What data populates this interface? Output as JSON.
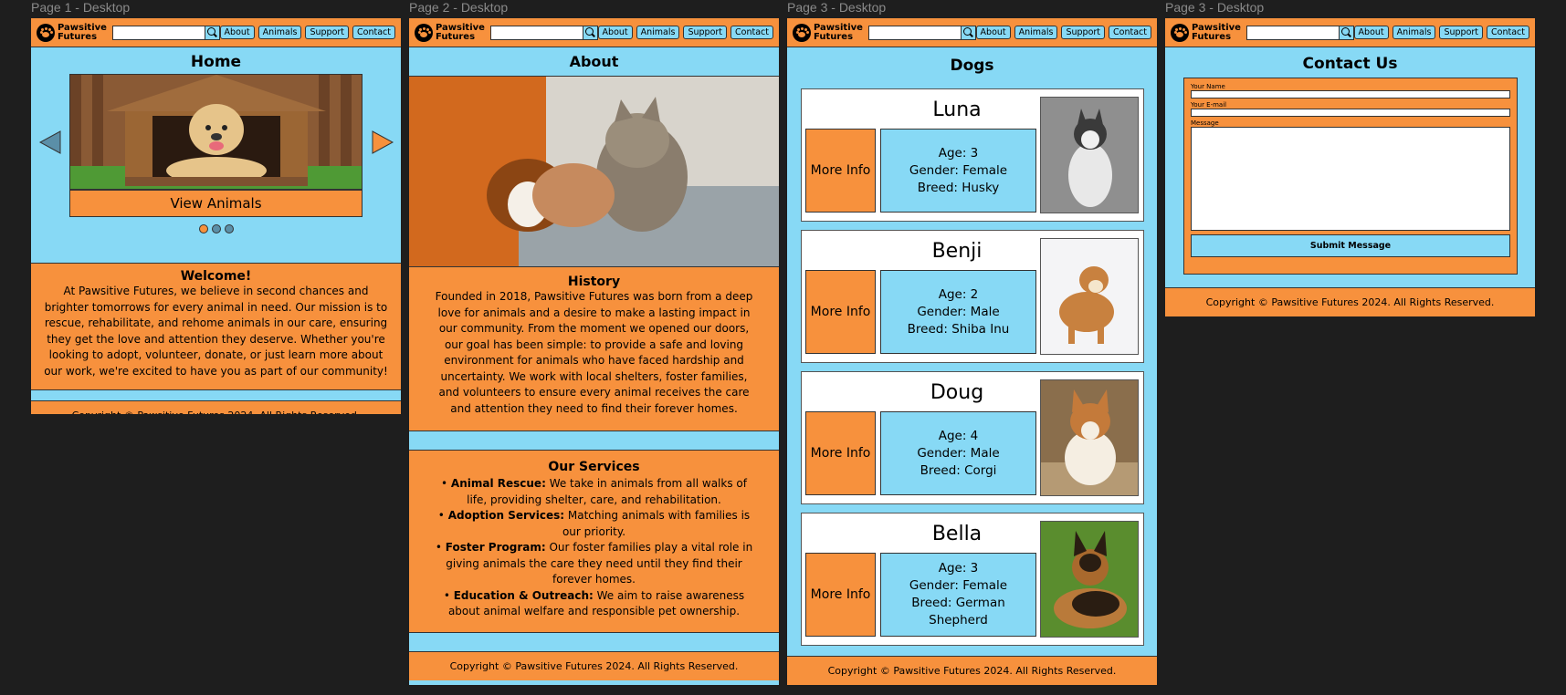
{
  "frames": [
    {
      "label": "Page 1 - Desktop"
    },
    {
      "label": "Page 2 - Desktop"
    },
    {
      "label": "Page 3 - Desktop"
    },
    {
      "label": "Page 3 - Desktop"
    }
  ],
  "nav": {
    "logo_line1": "Pawsitive",
    "logo_line2": "Futures",
    "search_placeholder": "",
    "links": [
      "About",
      "Animals",
      "Support",
      "Contact"
    ]
  },
  "footer": {
    "text": "Copyright © Pawsitive Futures 2024. All Rights Reserved."
  },
  "home": {
    "title": "Home",
    "carousel_button": "View Animals",
    "welcome_title": "Welcome!",
    "welcome_text": "At Pawsitive Futures, we believe in second chances and brighter tomorrows for every animal in need. Our mission is to rescue, rehabilitate, and rehome animals in our care, ensuring they get the love and attention they deserve. Whether you're looking to adopt, volunteer, donate, or just learn more about our work, we're excited to have you as part of our community!"
  },
  "about": {
    "title": "About",
    "history_title": "History",
    "history_text": "Founded in 2018, Pawsitive Futures was born from a deep love for animals and a desire to make a lasting impact in our community. From the moment we opened our doors, our goal has been simple: to provide a safe and loving environment for animals who have faced hardship and uncertainty. We work with local shelters, foster families, and volunteers to ensure every animal receives the care and attention they need to find their forever homes.",
    "services_title": "Our Services",
    "services": [
      {
        "name": "Animal Rescue:",
        "text": " We take in animals from all walks of life, providing shelter, care, and rehabilitation."
      },
      {
        "name": "Adoption Services:",
        "text": " Matching animals with families is our priority."
      },
      {
        "name": "Foster Program:",
        "text": " Our foster families play a vital role in giving animals the care they need until they find their forever homes."
      },
      {
        "name": "Education & Outreach:",
        "text": " We aim to raise awareness about animal welfare and responsible pet ownership."
      }
    ]
  },
  "dogs": {
    "title": "Dogs",
    "more_info": "More Info",
    "list": [
      {
        "name": "Luna",
        "age": "Age: 3",
        "gender": "Gender: Female",
        "breed": "Breed: Husky"
      },
      {
        "name": "Benji",
        "age": "Age: 2",
        "gender": "Gender: Male",
        "breed": "Breed: Shiba Inu"
      },
      {
        "name": "Doug",
        "age": "Age: 4",
        "gender": "Gender: Male",
        "breed": "Breed: Corgi"
      },
      {
        "name": "Bella",
        "age": "Age: 3",
        "gender": "Gender: Female",
        "breed": "Breed: German Shepherd"
      }
    ]
  },
  "contact": {
    "title": "Contact Us",
    "name_label": "Your Name",
    "email_label": "Your E-mail",
    "message_label": "Message",
    "submit": "Submit Message"
  },
  "colors": {
    "orange": "#f7913d",
    "blue": "#87d9f5",
    "canvas": "#1e1e1e"
  }
}
